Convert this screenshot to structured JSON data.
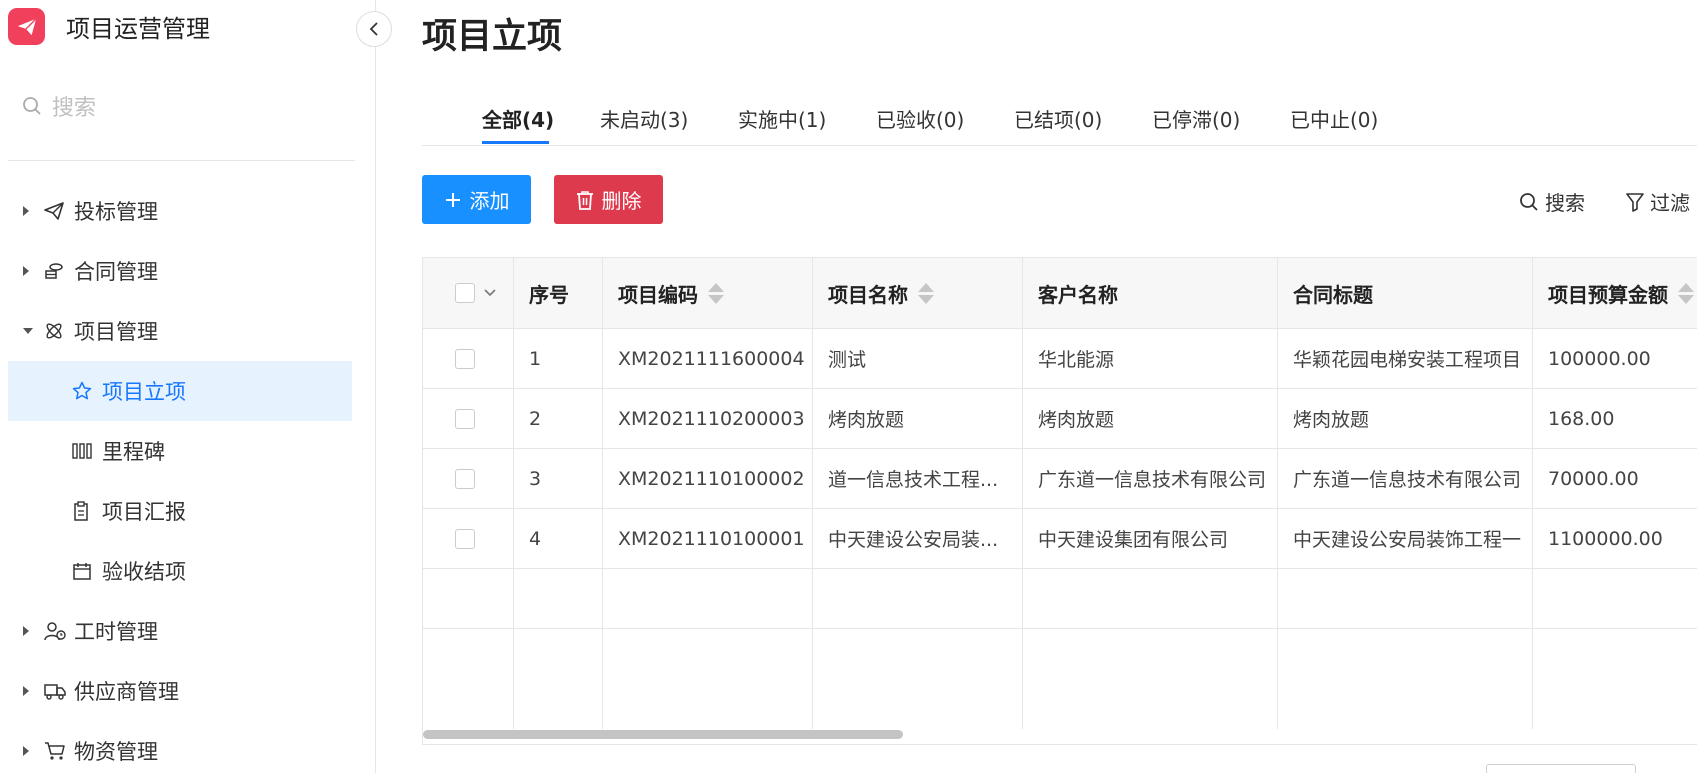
{
  "app": {
    "title": "项目运营管理",
    "brand_color": "#f0405b"
  },
  "sidebar": {
    "search_placeholder": "搜索",
    "items": [
      {
        "label": "投标管理",
        "icon": "send-icon"
      },
      {
        "label": "合同管理",
        "icon": "coins-icon"
      },
      {
        "label": "项目管理",
        "icon": "atom-icon",
        "expanded": true
      },
      {
        "label": "项目立项",
        "icon": "star-icon",
        "active": true
      },
      {
        "label": "里程碑",
        "icon": "columns-icon"
      },
      {
        "label": "项目汇报",
        "icon": "clipboard-icon"
      },
      {
        "label": "验收结项",
        "icon": "calendar-icon"
      },
      {
        "label": "工时管理",
        "icon": "user-clock-icon"
      },
      {
        "label": "供应商管理",
        "icon": "truck-icon"
      },
      {
        "label": "物资管理",
        "icon": "cart-icon"
      }
    ]
  },
  "main": {
    "title": "项目立项",
    "tabs": [
      "全部(4)",
      "未启动(3)",
      "实施中(1)",
      "已验收(0)",
      "已结项(0)",
      "已停滞(0)",
      "已中止(0)"
    ],
    "add_label": "添加",
    "delete_label": "删除",
    "search_label": "搜索",
    "filter_label": "过滤",
    "accent_color": "#1890ff",
    "danger_color": "#de3a4e"
  },
  "table": {
    "columns": [
      "序号",
      "项目编码",
      "项目名称",
      "客户名称",
      "合同标题",
      "项目预算金额"
    ],
    "rows": [
      [
        "1",
        "XM2021111600004",
        "测试",
        "华北能源",
        "华颖花园电梯安装工程项目",
        "100000.00"
      ],
      [
        "2",
        "XM2021110200003",
        "烤肉放题",
        "烤肉放题",
        "烤肉放题",
        "168.00"
      ],
      [
        "3",
        "XM2021110100002",
        "道一信息技术工程...",
        "广东道一信息技术有限公司",
        "广东道一信息技术有限公司",
        "70000.00"
      ],
      [
        "4",
        "XM2021110100001",
        "中天建设公安局装...",
        "中天建设集团有限公司",
        "中天建设公安局装饰工程一",
        "1100000.00"
      ]
    ]
  }
}
